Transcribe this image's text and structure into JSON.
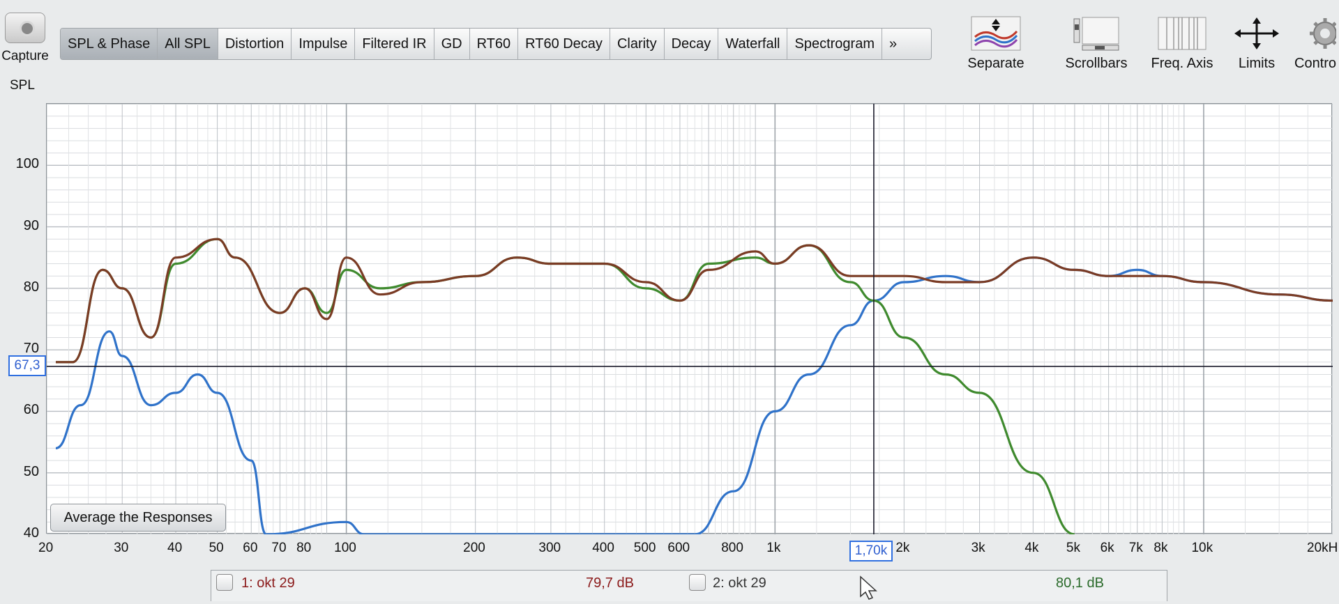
{
  "capture": {
    "label": "Capture"
  },
  "panel_label": "SPL",
  "tabs": [
    {
      "label": "SPL & Phase",
      "active": false
    },
    {
      "label": "All SPL",
      "active": true
    },
    {
      "label": "Distortion",
      "active": false
    },
    {
      "label": "Impulse",
      "active": false
    },
    {
      "label": "Filtered IR",
      "active": false
    },
    {
      "label": "GD",
      "active": false
    },
    {
      "label": "RT60",
      "active": false
    },
    {
      "label": "RT60 Decay",
      "active": false
    },
    {
      "label": "Clarity",
      "active": false
    },
    {
      "label": "Decay",
      "active": false
    },
    {
      "label": "Waterfall",
      "active": false
    },
    {
      "label": "Spectrogram",
      "active": false
    },
    {
      "label": "»",
      "active": false
    }
  ],
  "toolbar": {
    "separate": "Separate",
    "scrollbars": "Scrollbars",
    "freq_axis": "Freq. Axis",
    "limits": "Limits",
    "controls": "Contro"
  },
  "y_axis": {
    "ticks": [
      "100",
      "90",
      "80",
      "70",
      "60",
      "50",
      "40"
    ]
  },
  "x_axis": {
    "ticks": [
      "20",
      "30",
      "40",
      "50",
      "60",
      "70",
      "80",
      "100",
      "200",
      "300",
      "400",
      "500",
      "600",
      "800",
      "1k",
      "2k",
      "3k",
      "4k",
      "5k",
      "6k",
      "7k",
      "8k",
      "10k",
      "20kH"
    ]
  },
  "cursor": {
    "y_readout": "67,3",
    "x_readout": "1,70k"
  },
  "average_button": "Average the Responses",
  "legend": [
    {
      "label": "1: okt 29",
      "value": "79,7 dB",
      "color": "#8b1a1a"
    },
    {
      "label": "2: okt 29",
      "value": "80,1 dB",
      "color": "#2a6a2a"
    }
  ],
  "colors": {
    "blue": "#2f72c9",
    "green": "#3f8a2e",
    "brown": "#7a3b24",
    "grid": "#c4c8cc",
    "cursor": "#1a1a2a"
  },
  "chart_data": {
    "type": "line",
    "x_scale": "log",
    "xlim": [
      20,
      20000
    ],
    "ylim": [
      40,
      110
    ],
    "cursor": {
      "x": 1700,
      "y": 67.3
    },
    "series": [
      {
        "color": "#2f72c9",
        "x": [
          21,
          24,
          28,
          30,
          35,
          40,
          45,
          50,
          60,
          65,
          100,
          110,
          120,
          650,
          800,
          1000,
          1200,
          1500,
          1700,
          2000,
          2500,
          3000,
          4000,
          5000,
          6000,
          7000,
          8000,
          10000,
          15000,
          20000
        ],
        "y": [
          54,
          61,
          73,
          69,
          61,
          63,
          66,
          63,
          52,
          40,
          42,
          40,
          40,
          40,
          47,
          60,
          66,
          74,
          78,
          81,
          82,
          81,
          85,
          83,
          82,
          83,
          82,
          81,
          79,
          78
        ]
      },
      {
        "color": "#3f8a2e",
        "x": [
          21,
          23,
          27,
          30,
          35,
          40,
          50,
          55,
          70,
          80,
          90,
          100,
          120,
          150,
          200,
          250,
          300,
          400,
          500,
          600,
          700,
          900,
          1000,
          1200,
          1500,
          1700,
          2000,
          2500,
          3000,
          4000,
          5000
        ],
        "y": [
          68,
          68,
          83,
          80,
          72,
          84,
          88,
          85,
          76,
          80,
          76,
          83,
          80,
          81,
          82,
          85,
          84,
          84,
          80,
          78,
          84,
          85,
          84,
          87,
          81,
          78,
          72,
          66,
          63,
          50,
          40
        ]
      },
      {
        "color": "#7a3b24",
        "x": [
          21,
          23,
          27,
          30,
          35,
          40,
          50,
          55,
          70,
          80,
          90,
          100,
          120,
          150,
          200,
          250,
          300,
          400,
          500,
          600,
          700,
          900,
          1000,
          1200,
          1500,
          1700,
          2000,
          2500,
          3000,
          4000,
          5000,
          6000,
          7000,
          8000,
          10000,
          15000,
          20000
        ],
        "y": [
          68,
          68,
          83,
          80,
          72,
          85,
          88,
          85,
          76,
          80,
          75,
          85,
          79,
          81,
          82,
          85,
          84,
          84,
          81,
          78,
          83,
          86,
          84,
          87,
          82,
          82,
          82,
          81,
          81,
          85,
          83,
          82,
          82,
          82,
          81,
          79,
          78
        ]
      }
    ]
  }
}
